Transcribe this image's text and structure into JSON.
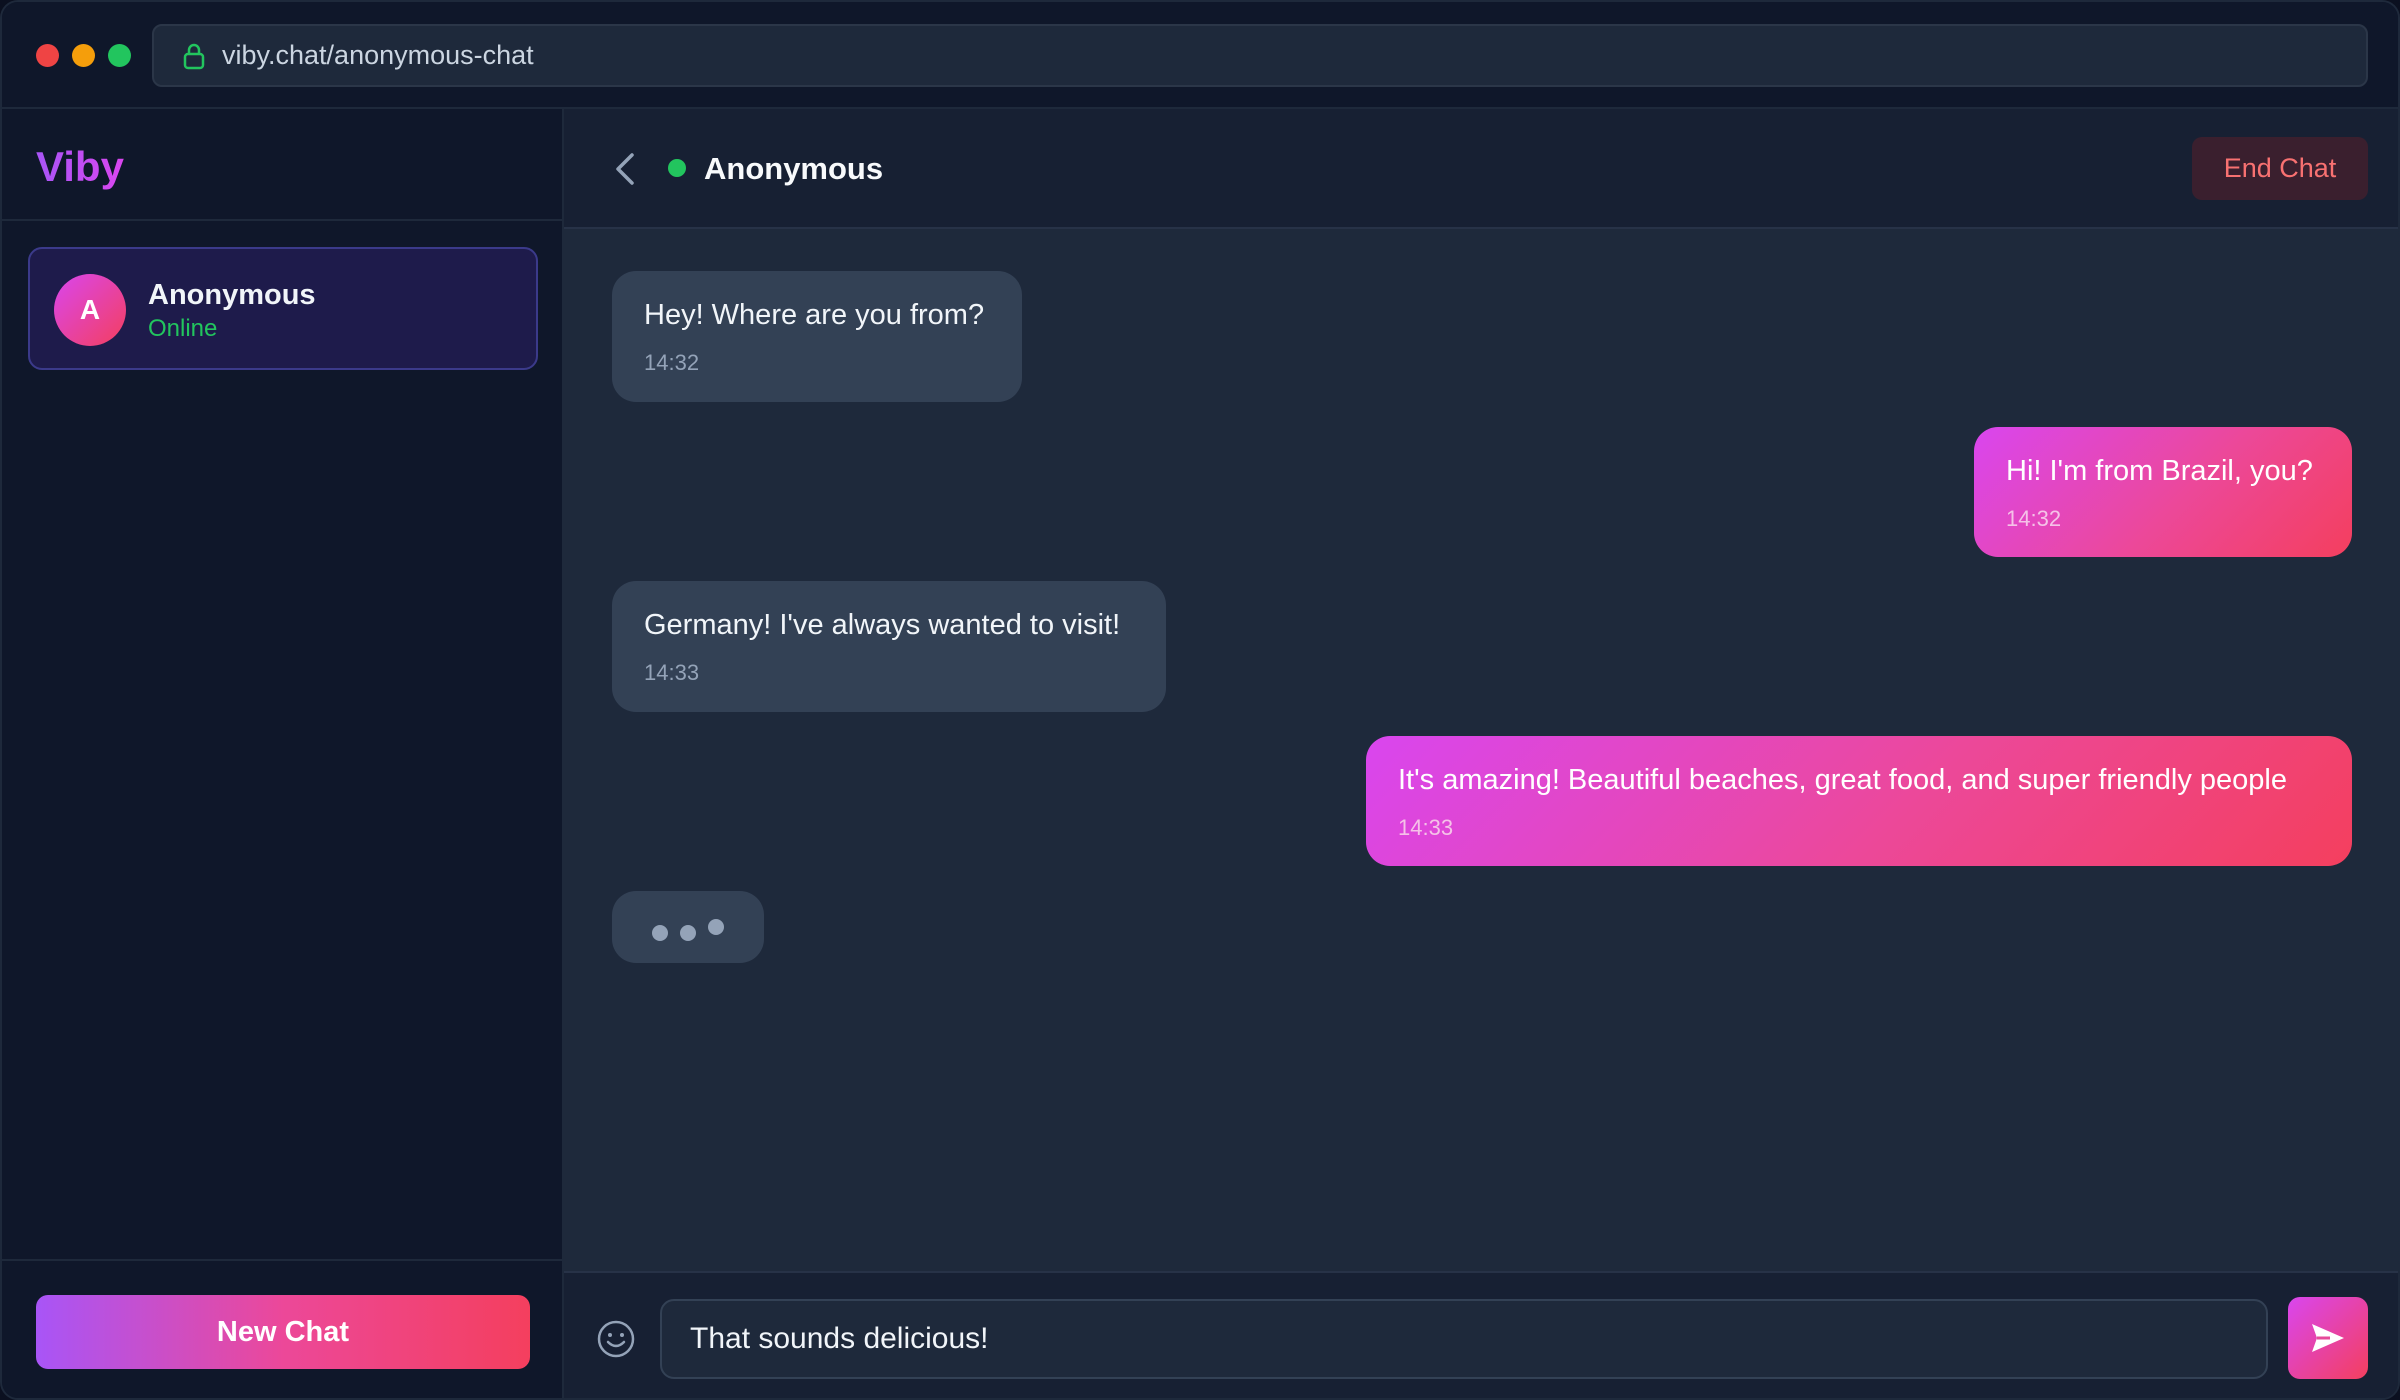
{
  "browser": {
    "url": "viby.chat/anonymous-chat"
  },
  "sidebar": {
    "brand": "Viby",
    "chats": [
      {
        "initial": "A",
        "name": "Anonymous",
        "status": "Online"
      }
    ],
    "new_chat_label": "New Chat"
  },
  "chat": {
    "partner_name": "Anonymous",
    "end_chat_label": "End Chat",
    "messages": [
      {
        "direction": "in",
        "text": "Hey! Where are you from?",
        "time": "14:32"
      },
      {
        "direction": "out",
        "text": "Hi! I'm from Brazil, you?",
        "time": "14:32"
      },
      {
        "direction": "in",
        "text": "Germany! I've always wanted to visit!",
        "time": "14:33"
      },
      {
        "direction": "out",
        "text": "It's amazing! Beautiful beaches, great food, and super friendly people",
        "time": "14:33"
      }
    ],
    "typing_indicator": true
  },
  "composer": {
    "value": "That sounds delicious!"
  },
  "icons": {
    "lock": "lock-icon",
    "back": "chevron-left-icon",
    "emoji": "smiley-icon",
    "send": "send-icon"
  },
  "colors": {
    "accent_start": "#d946ef",
    "accent_end": "#f43f5e",
    "online": "#22c55e",
    "end_chat_text": "#f87171"
  }
}
